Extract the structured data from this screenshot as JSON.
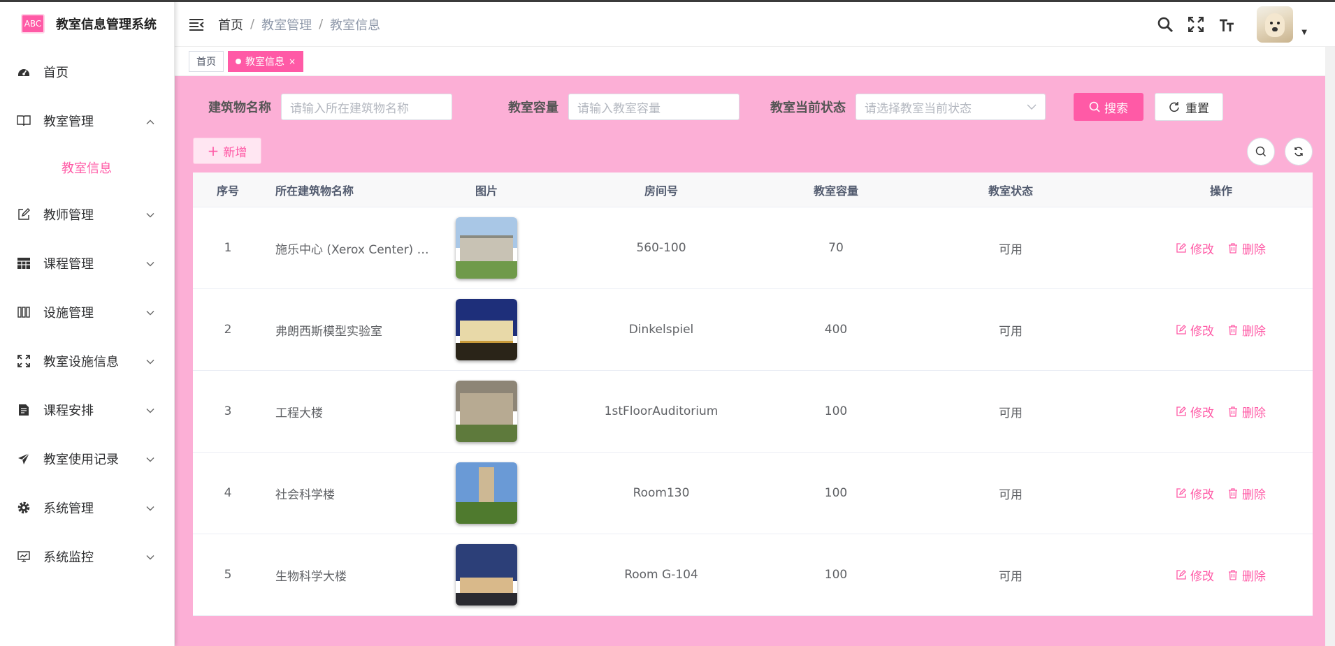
{
  "app": {
    "title": "教室信息管理系统",
    "logo_text": "ABC"
  },
  "sidebar": {
    "items": [
      {
        "label": "首页",
        "icon": "dashboard-icon"
      },
      {
        "label": "教室管理",
        "icon": "book-icon",
        "expanded": true,
        "children": [
          {
            "label": "教室信息"
          }
        ]
      },
      {
        "label": "教师管理",
        "icon": "edit-icon"
      },
      {
        "label": "课程管理",
        "icon": "table-icon"
      },
      {
        "label": "设施管理",
        "icon": "columns-icon"
      },
      {
        "label": "教室设施信息",
        "icon": "expand-icon"
      },
      {
        "label": "课程安排",
        "icon": "document-icon"
      },
      {
        "label": "教室使用记录",
        "icon": "send-icon"
      },
      {
        "label": "系统管理",
        "icon": "gear-icon"
      },
      {
        "label": "系统监控",
        "icon": "monitor-icon"
      }
    ]
  },
  "header": {
    "breadcrumb": [
      "首页",
      "教室管理",
      "教室信息"
    ],
    "separator": "/"
  },
  "tags": {
    "home": "首页",
    "active": "教室信息",
    "close": "×"
  },
  "filter": {
    "building_label": "建筑物名称",
    "building_placeholder": "请输入所在建筑物名称",
    "capacity_label": "教室容量",
    "capacity_placeholder": "请输入教室容量",
    "status_label": "教室当前状态",
    "status_placeholder": "请选择教室当前状态",
    "search_label": "搜索",
    "reset_label": "重置"
  },
  "toolbar": {
    "add_label": "新增"
  },
  "table": {
    "headers": [
      "序号",
      "所在建筑物名称",
      "图片",
      "房间号",
      "教室容量",
      "教室状态",
      "操作"
    ],
    "edit_label": "修改",
    "delete_label": "删除",
    "rows": [
      {
        "index": "1",
        "building": "施乐中心 (Xerox Center) -...",
        "room": "560-100",
        "capacity": "70",
        "status": "可用"
      },
      {
        "index": "2",
        "building": "弗朗西斯模型实验室",
        "room": "Dinkelspiel",
        "capacity": "400",
        "status": "可用"
      },
      {
        "index": "3",
        "building": "工程大楼",
        "room": "1stFloorAuditorium",
        "capacity": "100",
        "status": "可用"
      },
      {
        "index": "4",
        "building": "社会科学楼",
        "room": "Room130",
        "capacity": "100",
        "status": "可用"
      },
      {
        "index": "5",
        "building": "生物科学大楼",
        "room": "Room G-104",
        "capacity": "100",
        "status": "可用"
      }
    ]
  },
  "colors": {
    "accent": "#ff5aa6",
    "main_bg": "#fcafd6"
  }
}
